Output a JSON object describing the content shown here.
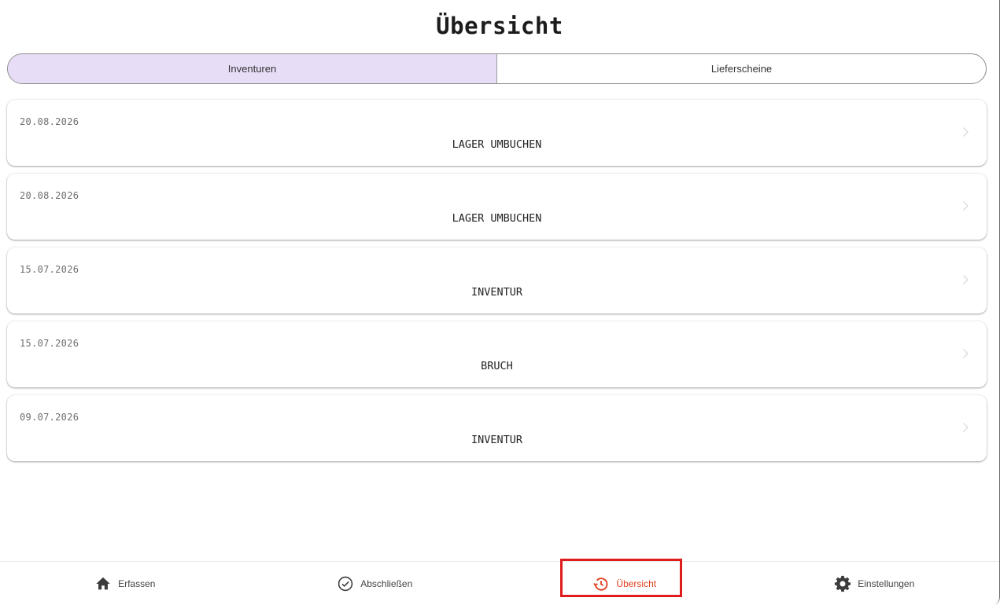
{
  "header": {
    "title": "Übersicht"
  },
  "tabs": [
    {
      "label": "Inventuren",
      "active": true
    },
    {
      "label": "Lieferscheine",
      "active": false
    }
  ],
  "entries": [
    {
      "date": "20.08.2026",
      "title": "LAGER UMBUCHEN"
    },
    {
      "date": "20.08.2026",
      "title": "LAGER UMBUCHEN"
    },
    {
      "date": "15.07.2026",
      "title": "INVENTUR"
    },
    {
      "date": "15.07.2026",
      "title": "BRUCH"
    },
    {
      "date": "09.07.2026",
      "title": "INVENTUR"
    }
  ],
  "bottom_nav": [
    {
      "label": "Erfassen",
      "icon": "home-icon",
      "active": false
    },
    {
      "label": "Abschließen",
      "icon": "check-circle-icon",
      "active": false
    },
    {
      "label": "Übersicht",
      "icon": "history-icon",
      "active": true
    },
    {
      "label": "Einstellungen",
      "icon": "gear-icon",
      "active": false
    }
  ],
  "colors": {
    "active_tab_bg": "#e8ddf7",
    "nav_active": "#e2411f",
    "highlight_box": "#e01c1c"
  }
}
